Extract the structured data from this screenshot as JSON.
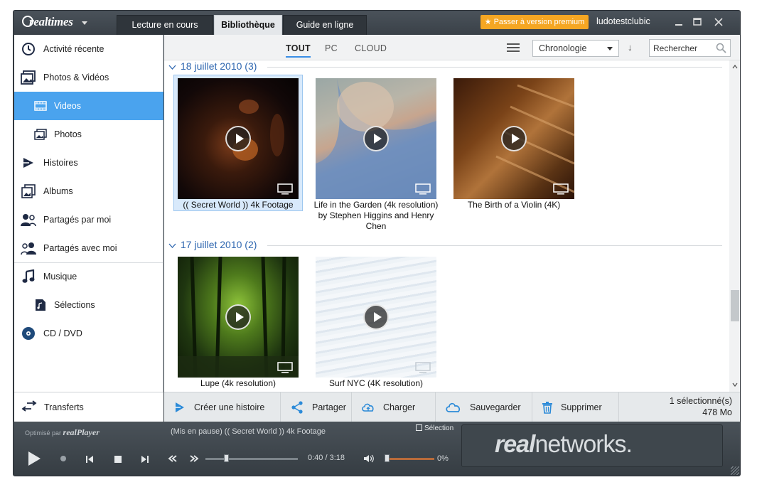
{
  "app": {
    "logo": "realtimes",
    "tabs": [
      {
        "label": "Lecture en cours",
        "active": false
      },
      {
        "label": "Bibliothèque",
        "active": true
      },
      {
        "label": "Guide en ligne",
        "active": false
      }
    ],
    "premium_label": "★ Passer à version premium",
    "username": "ludotestclubic"
  },
  "sidebar": {
    "items": [
      {
        "label": "Activité récente",
        "icon": "clock-icon"
      },
      {
        "label": "Photos & Vidéos",
        "icon": "photos-icon"
      },
      {
        "label": "Videos",
        "icon": "film-icon",
        "selected": true
      },
      {
        "label": "Photos",
        "icon": "photo-icon"
      },
      {
        "label": "Histoires",
        "icon": "story-icon"
      },
      {
        "label": "Albums",
        "icon": "album-icon"
      },
      {
        "label": "Partagés par moi",
        "icon": "shared-by-me-icon"
      },
      {
        "label": "Partagés avec moi",
        "icon": "shared-with-me-icon"
      },
      {
        "label": "Musique",
        "icon": "music-icon"
      },
      {
        "label": "Sélections",
        "icon": "playlist-icon"
      },
      {
        "label": "CD / DVD",
        "icon": "disc-icon"
      }
    ],
    "transfers_label": "Transferts"
  },
  "filters": {
    "items": [
      "TOUT",
      "PC",
      "CLOUD"
    ],
    "active": "TOUT",
    "sort_value": "Chronologie",
    "search_placeholder": "Rechercher"
  },
  "groups": [
    {
      "title": "18 juillet 2010 (3)",
      "items": [
        {
          "caption": "(( Secret World )) 4k Footage",
          "selected": true
        },
        {
          "caption": "Life in the Garden (4k resolution) by Stephen Higgins and Henry Chen"
        },
        {
          "caption": "The Birth of a Violin (4K)"
        }
      ]
    },
    {
      "title": "17 juillet 2010 (2)",
      "items": [
        {
          "caption": "Lupe  (4k resolution)"
        },
        {
          "caption": "Surf NYC (4K resolution)"
        }
      ]
    }
  ],
  "actions": {
    "create_story": "Créer une histoire",
    "share": "Partager",
    "upload": "Charger",
    "save": "Sauvegarder",
    "delete": "Supprimer",
    "selection_count": "1 sélectionné(s)",
    "selection_size": "478 Mo"
  },
  "player": {
    "powered_by": "Optimisé par",
    "powered_brand": "realPlayer",
    "now_playing": "(Mis en pause) (( Secret World )) 4k Footage",
    "playlist_label": "Sélection",
    "time": "0:40 / 3:18",
    "progress": 0.2,
    "volume_pct": "0%",
    "brand_bold": "real",
    "brand_rest": "networks."
  },
  "colors": {
    "accent": "#4aa3ee",
    "link_blue": "#2f67b0",
    "premium": "#f5a623"
  }
}
